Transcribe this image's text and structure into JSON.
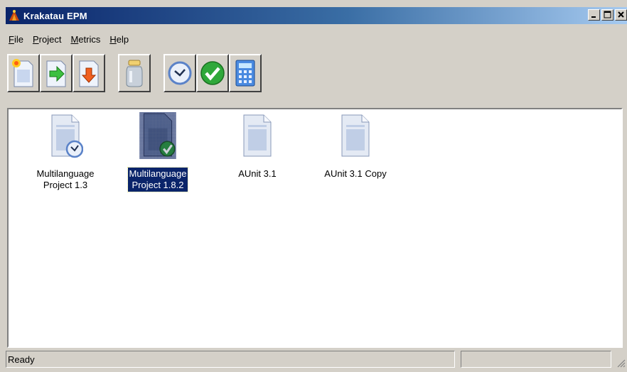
{
  "window": {
    "title": "Krakatau EPM",
    "buttons": [
      "minimize-icon",
      "maximize-icon",
      "close-icon"
    ]
  },
  "menu": {
    "items": [
      {
        "label": "File",
        "accel": "F",
        "rest": "ile"
      },
      {
        "label": "Project",
        "accel": "P",
        "rest": "roject"
      },
      {
        "label": "Metrics",
        "accel": "M",
        "rest": "etrics"
      },
      {
        "label": "Help",
        "accel": "H",
        "rest": "elp"
      }
    ]
  },
  "toolbar": {
    "buttons": [
      "new-project-icon",
      "import-project-icon",
      "export-project-icon",
      "jar-icon",
      "clock-icon",
      "check-icon",
      "calculator-icon"
    ]
  },
  "projects": [
    {
      "label": "Multilanguage\nProject 1.3",
      "badge": "clock",
      "selected": false
    },
    {
      "label": "Multilanguage\nProject 1.8.2",
      "badge": "check",
      "selected": true
    },
    {
      "label": "AUnit 3.1",
      "badge": "none",
      "selected": false
    },
    {
      "label": "AUnit 3.1 Copy",
      "badge": "none",
      "selected": false
    }
  ],
  "statusbar": {
    "text": "Ready"
  },
  "colors": {
    "titlebar_start": "#0a246a",
    "titlebar_end": "#a6caf0",
    "selection": "#0a246a",
    "check_green": "#2fa83a",
    "clock_blue": "#5a82c8"
  }
}
